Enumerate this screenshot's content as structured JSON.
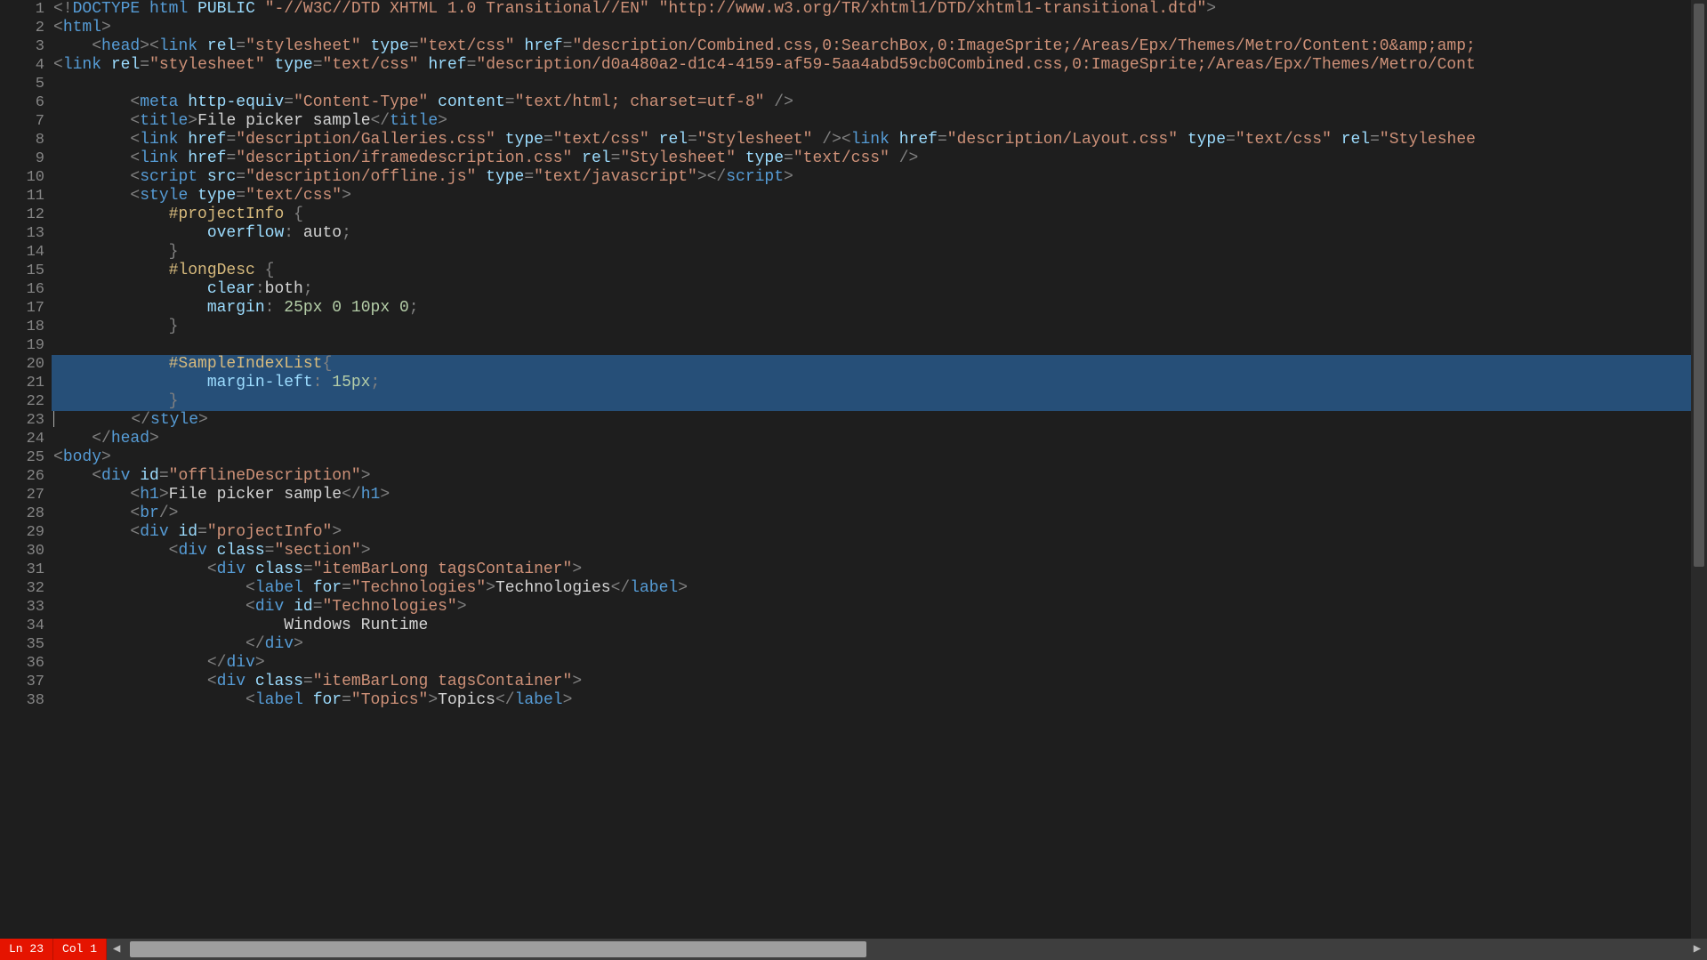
{
  "status": {
    "line_label": "Ln 23",
    "col_label": "Col 1"
  },
  "editor": {
    "first_line_number": 1,
    "selected_lines": [
      20,
      21,
      22
    ],
    "cursor_line": 23
  },
  "lines": [
    {
      "n": 1,
      "tokens": [
        [
          "p",
          "<!"
        ],
        [
          "kw",
          "DOCTYPE"
        ],
        [
          "txt",
          " "
        ],
        [
          "kw",
          "html"
        ],
        [
          "txt",
          " "
        ],
        [
          "an",
          "PUBLIC"
        ],
        [
          "txt",
          " "
        ],
        [
          "s",
          "\"-//W3C//DTD XHTML 1.0 Transitional//EN\""
        ],
        [
          "txt",
          " "
        ],
        [
          "s",
          "\"http://www.w3.org/TR/xhtml1/DTD/xhtml1-transitional.dtd\""
        ],
        [
          "p",
          ">"
        ]
      ]
    },
    {
      "n": 2,
      "tokens": [
        [
          "p",
          "<"
        ],
        [
          "tn",
          "html"
        ],
        [
          "p",
          ">"
        ]
      ]
    },
    {
      "n": 3,
      "tokens": [
        [
          "txt",
          "    "
        ],
        [
          "p",
          "<"
        ],
        [
          "tn",
          "head"
        ],
        [
          "p",
          "><"
        ],
        [
          "tn",
          "link"
        ],
        [
          "txt",
          " "
        ],
        [
          "an",
          "rel"
        ],
        [
          "p",
          "="
        ],
        [
          "s",
          "\"stylesheet\""
        ],
        [
          "txt",
          " "
        ],
        [
          "an",
          "type"
        ],
        [
          "p",
          "="
        ],
        [
          "s",
          "\"text/css\""
        ],
        [
          "txt",
          " "
        ],
        [
          "an",
          "href"
        ],
        [
          "p",
          "="
        ],
        [
          "s",
          "\"description/Combined.css,0:SearchBox,0:ImageSprite;/Areas/Epx/Themes/Metro/Content:0&amp;amp;"
        ]
      ]
    },
    {
      "n": 4,
      "tokens": [
        [
          "p",
          "<"
        ],
        [
          "tn",
          "link"
        ],
        [
          "txt",
          " "
        ],
        [
          "an",
          "rel"
        ],
        [
          "p",
          "="
        ],
        [
          "s",
          "\"stylesheet\""
        ],
        [
          "txt",
          " "
        ],
        [
          "an",
          "type"
        ],
        [
          "p",
          "="
        ],
        [
          "s",
          "\"text/css\""
        ],
        [
          "txt",
          " "
        ],
        [
          "an",
          "href"
        ],
        [
          "p",
          "="
        ],
        [
          "s",
          "\"description/d0a480a2-d1c4-4159-af59-5aa4abd59cb0Combined.css,0:ImageSprite;/Areas/Epx/Themes/Metro/Cont"
        ]
      ]
    },
    {
      "n": 5,
      "tokens": [
        [
          "txt",
          " "
        ]
      ]
    },
    {
      "n": 6,
      "tokens": [
        [
          "txt",
          "        "
        ],
        [
          "p",
          "<"
        ],
        [
          "tn",
          "meta"
        ],
        [
          "txt",
          " "
        ],
        [
          "an",
          "http-equiv"
        ],
        [
          "p",
          "="
        ],
        [
          "s",
          "\"Content-Type\""
        ],
        [
          "txt",
          " "
        ],
        [
          "an",
          "content"
        ],
        [
          "p",
          "="
        ],
        [
          "s",
          "\"text/html; charset=utf-8\""
        ],
        [
          "txt",
          " "
        ],
        [
          "p",
          "/>"
        ]
      ]
    },
    {
      "n": 7,
      "tokens": [
        [
          "txt",
          "        "
        ],
        [
          "p",
          "<"
        ],
        [
          "tn",
          "title"
        ],
        [
          "p",
          ">"
        ],
        [
          "txt",
          "File picker sample"
        ],
        [
          "p",
          "</"
        ],
        [
          "tn",
          "title"
        ],
        [
          "p",
          ">"
        ]
      ]
    },
    {
      "n": 8,
      "tokens": [
        [
          "txt",
          "        "
        ],
        [
          "p",
          "<"
        ],
        [
          "tn",
          "link"
        ],
        [
          "txt",
          " "
        ],
        [
          "an",
          "href"
        ],
        [
          "p",
          "="
        ],
        [
          "s",
          "\"description/Galleries.css\""
        ],
        [
          "txt",
          " "
        ],
        [
          "an",
          "type"
        ],
        [
          "p",
          "="
        ],
        [
          "s",
          "\"text/css\""
        ],
        [
          "txt",
          " "
        ],
        [
          "an",
          "rel"
        ],
        [
          "p",
          "="
        ],
        [
          "s",
          "\"Stylesheet\""
        ],
        [
          "txt",
          " "
        ],
        [
          "p",
          "/><"
        ],
        [
          "tn",
          "link"
        ],
        [
          "txt",
          " "
        ],
        [
          "an",
          "href"
        ],
        [
          "p",
          "="
        ],
        [
          "s",
          "\"description/Layout.css\""
        ],
        [
          "txt",
          " "
        ],
        [
          "an",
          "type"
        ],
        [
          "p",
          "="
        ],
        [
          "s",
          "\"text/css\""
        ],
        [
          "txt",
          " "
        ],
        [
          "an",
          "rel"
        ],
        [
          "p",
          "="
        ],
        [
          "s",
          "\"Styleshee"
        ]
      ]
    },
    {
      "n": 9,
      "tokens": [
        [
          "txt",
          "        "
        ],
        [
          "p",
          "<"
        ],
        [
          "tn",
          "link"
        ],
        [
          "txt",
          " "
        ],
        [
          "an",
          "href"
        ],
        [
          "p",
          "="
        ],
        [
          "s",
          "\"description/iframedescription.css\""
        ],
        [
          "txt",
          " "
        ],
        [
          "an",
          "rel"
        ],
        [
          "p",
          "="
        ],
        [
          "s",
          "\"Stylesheet\""
        ],
        [
          "txt",
          " "
        ],
        [
          "an",
          "type"
        ],
        [
          "p",
          "="
        ],
        [
          "s",
          "\"text/css\""
        ],
        [
          "txt",
          " "
        ],
        [
          "p",
          "/>"
        ]
      ]
    },
    {
      "n": 10,
      "tokens": [
        [
          "txt",
          "        "
        ],
        [
          "p",
          "<"
        ],
        [
          "tn",
          "script"
        ],
        [
          "txt",
          " "
        ],
        [
          "an",
          "src"
        ],
        [
          "p",
          "="
        ],
        [
          "s",
          "\"description/offline.js\""
        ],
        [
          "txt",
          " "
        ],
        [
          "an",
          "type"
        ],
        [
          "p",
          "="
        ],
        [
          "s",
          "\"text/javascript\""
        ],
        [
          "p",
          "></"
        ],
        [
          "tn",
          "script"
        ],
        [
          "p",
          ">"
        ]
      ]
    },
    {
      "n": 11,
      "tokens": [
        [
          "txt",
          "        "
        ],
        [
          "p",
          "<"
        ],
        [
          "tn",
          "style"
        ],
        [
          "txt",
          " "
        ],
        [
          "an",
          "type"
        ],
        [
          "p",
          "="
        ],
        [
          "s",
          "\"text/css\""
        ],
        [
          "p",
          ">"
        ]
      ]
    },
    {
      "n": 12,
      "tokens": [
        [
          "txt",
          "            "
        ],
        [
          "sel2",
          "#projectInfo"
        ],
        [
          "txt",
          " "
        ],
        [
          "p",
          "{"
        ]
      ]
    },
    {
      "n": 13,
      "tokens": [
        [
          "txt",
          "                "
        ],
        [
          "prop",
          "overflow"
        ],
        [
          "p",
          ":"
        ],
        [
          "txt",
          " "
        ],
        [
          "txt",
          "auto"
        ],
        [
          "p",
          ";"
        ]
      ]
    },
    {
      "n": 14,
      "tokens": [
        [
          "txt",
          "            "
        ],
        [
          "p",
          "}"
        ]
      ]
    },
    {
      "n": 15,
      "tokens": [
        [
          "txt",
          "            "
        ],
        [
          "sel2",
          "#longDesc"
        ],
        [
          "txt",
          " "
        ],
        [
          "p",
          "{"
        ]
      ]
    },
    {
      "n": 16,
      "tokens": [
        [
          "txt",
          "                "
        ],
        [
          "prop",
          "clear"
        ],
        [
          "p",
          ":"
        ],
        [
          "txt",
          "both"
        ],
        [
          "p",
          ";"
        ]
      ]
    },
    {
      "n": 17,
      "tokens": [
        [
          "txt",
          "                "
        ],
        [
          "prop",
          "margin"
        ],
        [
          "p",
          ":"
        ],
        [
          "txt",
          " "
        ],
        [
          "num",
          "25px"
        ],
        [
          "txt",
          " "
        ],
        [
          "num",
          "0"
        ],
        [
          "txt",
          " "
        ],
        [
          "num",
          "10px"
        ],
        [
          "txt",
          " "
        ],
        [
          "num",
          "0"
        ],
        [
          "p",
          ";"
        ]
      ]
    },
    {
      "n": 18,
      "tokens": [
        [
          "txt",
          "            "
        ],
        [
          "p",
          "}"
        ]
      ]
    },
    {
      "n": 19,
      "tokens": [
        [
          "txt",
          " "
        ]
      ]
    },
    {
      "n": 20,
      "tokens": [
        [
          "txt",
          "            "
        ],
        [
          "sel2",
          "#SampleIndexList"
        ],
        [
          "p",
          "{"
        ]
      ]
    },
    {
      "n": 21,
      "tokens": [
        [
          "txt",
          "                "
        ],
        [
          "prop",
          "margin-left"
        ],
        [
          "p",
          ":"
        ],
        [
          "txt",
          " "
        ],
        [
          "num",
          "15px"
        ],
        [
          "p",
          ";"
        ]
      ]
    },
    {
      "n": 22,
      "tokens": [
        [
          "txt",
          "            "
        ],
        [
          "p",
          "}"
        ]
      ]
    },
    {
      "n": 23,
      "tokens": [
        [
          "txt",
          "        "
        ],
        [
          "p",
          "</"
        ],
        [
          "tn",
          "style"
        ],
        [
          "p",
          ">"
        ]
      ]
    },
    {
      "n": 24,
      "tokens": [
        [
          "txt",
          "    "
        ],
        [
          "p",
          "</"
        ],
        [
          "tn",
          "head"
        ],
        [
          "p",
          ">"
        ]
      ]
    },
    {
      "n": 25,
      "tokens": [
        [
          "p",
          "<"
        ],
        [
          "tn",
          "body"
        ],
        [
          "p",
          ">"
        ]
      ]
    },
    {
      "n": 26,
      "tokens": [
        [
          "txt",
          "    "
        ],
        [
          "p",
          "<"
        ],
        [
          "tn",
          "div"
        ],
        [
          "txt",
          " "
        ],
        [
          "an",
          "id"
        ],
        [
          "p",
          "="
        ],
        [
          "s",
          "\"offlineDescription\""
        ],
        [
          "p",
          ">"
        ]
      ]
    },
    {
      "n": 27,
      "tokens": [
        [
          "txt",
          "        "
        ],
        [
          "p",
          "<"
        ],
        [
          "tn",
          "h1"
        ],
        [
          "p",
          ">"
        ],
        [
          "txt",
          "File picker sample"
        ],
        [
          "p",
          "</"
        ],
        [
          "tn",
          "h1"
        ],
        [
          "p",
          ">"
        ]
      ]
    },
    {
      "n": 28,
      "tokens": [
        [
          "txt",
          "        "
        ],
        [
          "p",
          "<"
        ],
        [
          "tn",
          "br"
        ],
        [
          "p",
          "/>"
        ]
      ]
    },
    {
      "n": 29,
      "tokens": [
        [
          "txt",
          "        "
        ],
        [
          "p",
          "<"
        ],
        [
          "tn",
          "div"
        ],
        [
          "txt",
          " "
        ],
        [
          "an",
          "id"
        ],
        [
          "p",
          "="
        ],
        [
          "s",
          "\"projectInfo\""
        ],
        [
          "p",
          ">"
        ]
      ]
    },
    {
      "n": 30,
      "tokens": [
        [
          "txt",
          "            "
        ],
        [
          "p",
          "<"
        ],
        [
          "tn",
          "div"
        ],
        [
          "txt",
          " "
        ],
        [
          "an",
          "class"
        ],
        [
          "p",
          "="
        ],
        [
          "s",
          "\"section\""
        ],
        [
          "p",
          ">"
        ]
      ]
    },
    {
      "n": 31,
      "tokens": [
        [
          "txt",
          "                "
        ],
        [
          "p",
          "<"
        ],
        [
          "tn",
          "div"
        ],
        [
          "txt",
          " "
        ],
        [
          "an",
          "class"
        ],
        [
          "p",
          "="
        ],
        [
          "s",
          "\"itemBarLong tagsContainer\""
        ],
        [
          "p",
          ">"
        ]
      ]
    },
    {
      "n": 32,
      "tokens": [
        [
          "txt",
          "                    "
        ],
        [
          "p",
          "<"
        ],
        [
          "tn",
          "label"
        ],
        [
          "txt",
          " "
        ],
        [
          "an",
          "for"
        ],
        [
          "p",
          "="
        ],
        [
          "s",
          "\"Technologies\""
        ],
        [
          "p",
          ">"
        ],
        [
          "txt",
          "Technologies"
        ],
        [
          "p",
          "</"
        ],
        [
          "tn",
          "label"
        ],
        [
          "p",
          ">"
        ]
      ]
    },
    {
      "n": 33,
      "tokens": [
        [
          "txt",
          "                    "
        ],
        [
          "p",
          "<"
        ],
        [
          "tn",
          "div"
        ],
        [
          "txt",
          " "
        ],
        [
          "an",
          "id"
        ],
        [
          "p",
          "="
        ],
        [
          "s",
          "\"Technologies\""
        ],
        [
          "p",
          ">"
        ]
      ]
    },
    {
      "n": 34,
      "tokens": [
        [
          "txt",
          "                        Windows Runtime"
        ]
      ]
    },
    {
      "n": 35,
      "tokens": [
        [
          "txt",
          "                    "
        ],
        [
          "p",
          "</"
        ],
        [
          "tn",
          "div"
        ],
        [
          "p",
          ">"
        ]
      ]
    },
    {
      "n": 36,
      "tokens": [
        [
          "txt",
          "                "
        ],
        [
          "p",
          "</"
        ],
        [
          "tn",
          "div"
        ],
        [
          "p",
          ">"
        ]
      ]
    },
    {
      "n": 37,
      "tokens": [
        [
          "txt",
          "                "
        ],
        [
          "p",
          "<"
        ],
        [
          "tn",
          "div"
        ],
        [
          "txt",
          " "
        ],
        [
          "an",
          "class"
        ],
        [
          "p",
          "="
        ],
        [
          "s",
          "\"itemBarLong tagsContainer\""
        ],
        [
          "p",
          ">"
        ]
      ]
    },
    {
      "n": 38,
      "tokens": [
        [
          "txt",
          "                    "
        ],
        [
          "p",
          "<"
        ],
        [
          "tn",
          "label"
        ],
        [
          "txt",
          " "
        ],
        [
          "an",
          "for"
        ],
        [
          "p",
          "="
        ],
        [
          "s",
          "\"Topics\""
        ],
        [
          "p",
          ">"
        ],
        [
          "txt",
          "Topics"
        ],
        [
          "p",
          "</"
        ],
        [
          "tn",
          "label"
        ],
        [
          "p",
          ">"
        ]
      ]
    }
  ]
}
